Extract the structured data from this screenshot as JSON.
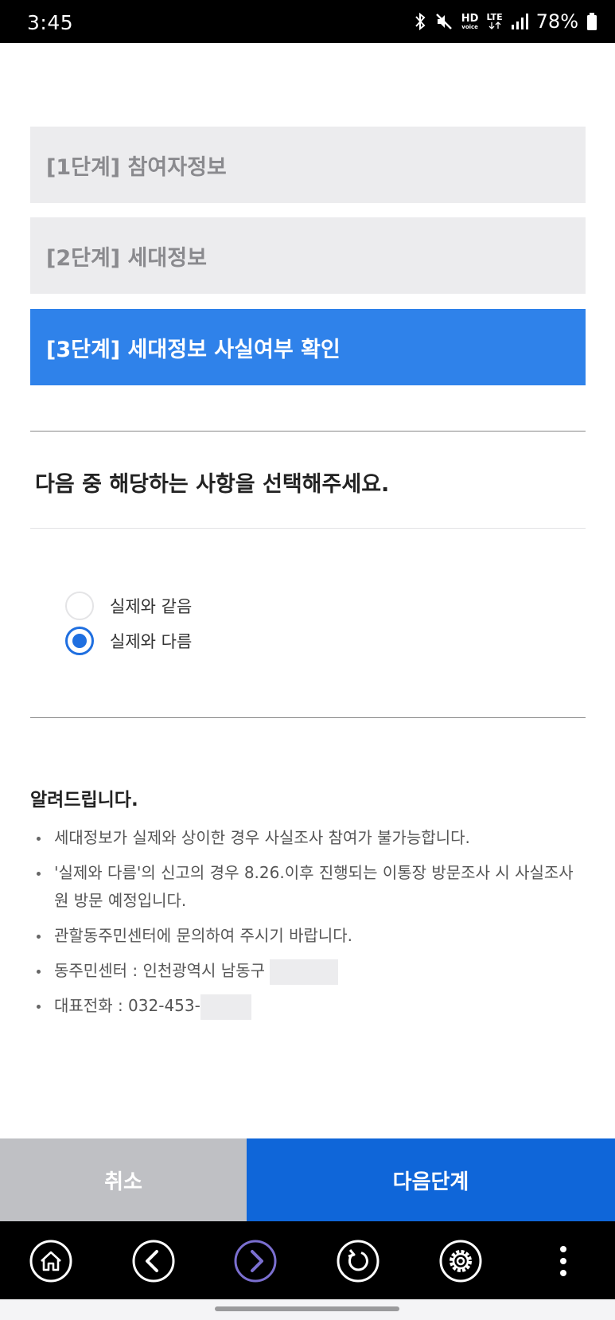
{
  "status_bar": {
    "time": "3:45",
    "icons": [
      "bluetooth-icon",
      "mute-icon",
      "hd-voice-icon",
      "lte-icon",
      "signal-icon",
      "battery-icon"
    ],
    "hd_top": "HD",
    "hd_bottom": "voice",
    "lte": "LTE",
    "battery": "78%"
  },
  "steps": [
    {
      "label": "[1단계] 참여자정보",
      "active": false
    },
    {
      "label": "[2단계] 세대정보",
      "active": false
    },
    {
      "label": "[3단계] 세대정보 사실여부 확인",
      "active": true
    }
  ],
  "question": "다음 중 해당하는 사항을 선택해주세요.",
  "options": [
    {
      "label": "실제와 같음",
      "checked": false
    },
    {
      "label": "실제와 다름",
      "checked": true
    }
  ],
  "notice": {
    "title": "알려드립니다.",
    "items": [
      "세대정보가 실제와 상이한 경우 사실조사 참여가 불가능합니다.",
      "'실제와 다름'의 신고의 경우 8.26.이후 진행되는 이통장 방문조사 시 사실조사원 방문 예정입니다.",
      "관할동주민센터에 문의하여 주시기 바랍니다.",
      "동주민센터 : 인천광역시 남동구",
      "대표전화 : 032-453-"
    ]
  },
  "buttons": {
    "cancel": "취소",
    "next": "다음단계"
  },
  "nav_bar": {
    "icons": [
      "home-icon",
      "back-icon",
      "forward-icon",
      "refresh-icon",
      "settings-icon",
      "more-icon"
    ]
  },
  "colors": {
    "active_step": "#2f82ea",
    "inactive_step": "#ececee",
    "next_button": "#0f66d9",
    "cancel_button": "#bfc0c4",
    "radio_checked": "#1f6fe0",
    "forward_icon": "#7b6fd0"
  }
}
